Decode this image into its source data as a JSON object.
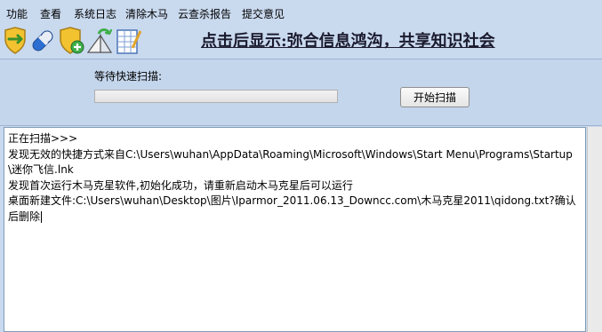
{
  "menu": [
    "功能",
    "查看",
    "系统日志",
    "清除木马",
    "云查杀报告",
    "提交意见"
  ],
  "toolbar": {
    "icons": [
      "shield-scan-icon",
      "pill-icon",
      "shield-add-icon",
      "refresh-ruler-icon",
      "notepad-icon"
    ]
  },
  "banner": {
    "text": "点击后显示:弥合信息鸿沟，共享知识社会"
  },
  "scan": {
    "label": "等待快速扫描:",
    "progress": 0,
    "button_label": "开始扫描"
  },
  "log": {
    "lines": [
      "正在扫描>>>",
      "发现无效的快捷方式来自C:\\Users\\wuhan\\AppData\\Roaming\\Microsoft\\Windows\\Start Menu\\Programs\\Startup\\迷你飞信.lnk",
      "发现首次运行木马克星软件,初始化成功，请重新启动木马克星后可以运行",
      "桌面新建文件:C:\\Users\\wuhan\\Desktop\\图片\\Iparmor_2011.06.13_Downcc.com\\木马克星2011\\qidong.txt?确认后删除"
    ]
  },
  "colors": {
    "background": "#c9d9ee",
    "progress_green": "#3fae49"
  }
}
